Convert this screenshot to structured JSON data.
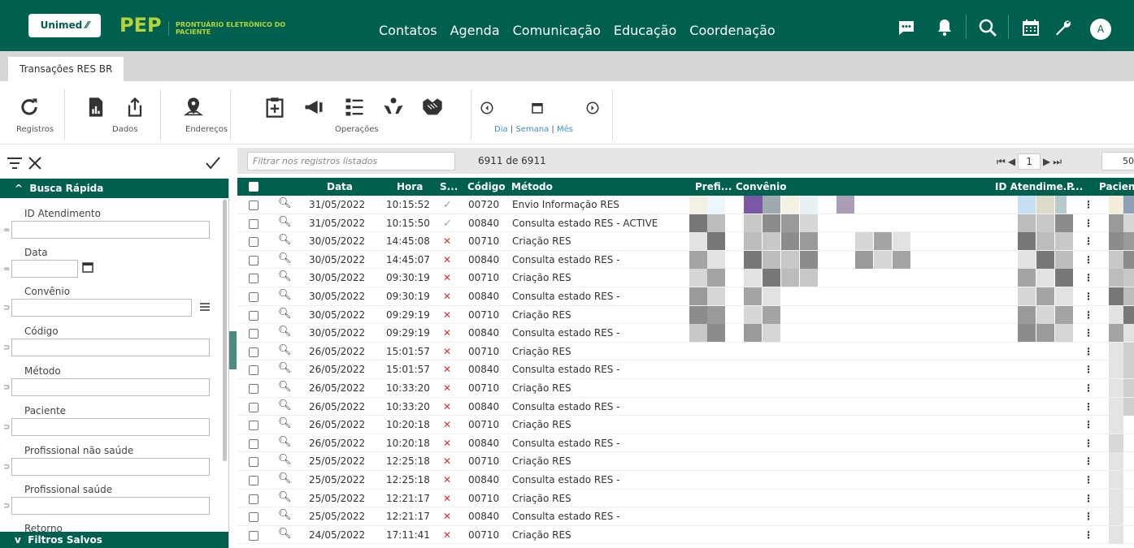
{
  "header": {
    "logo": "Unimed",
    "app_short": "PEP",
    "app_sub": "PRONTUÁRIO ELETRÔNICO DO PACIENTE",
    "nav": [
      "Contatos",
      "Agenda",
      "Comunicação",
      "Educação",
      "Coordenação"
    ],
    "avatar": "A"
  },
  "tab": {
    "label": "Transações RES BR"
  },
  "toolbar": {
    "registros": "Registros",
    "dados": "Dados",
    "enderecos": "Endereços",
    "operacoes": "Operações",
    "dia": "Dia",
    "semana": "Semana",
    "mes": "Mês"
  },
  "leftpanel": {
    "busca": "Busca Rápida",
    "filtros": "Filtros Salvos",
    "fields": [
      {
        "label": "ID Atendimento",
        "op": "="
      },
      {
        "label": "Data",
        "op": "="
      },
      {
        "label": "Convênio",
        "op": "⊃"
      },
      {
        "label": "Código",
        "op": "⊃"
      },
      {
        "label": "Método",
        "op": "⊃"
      },
      {
        "label": "Paciente",
        "op": "⊃"
      },
      {
        "label": "Profissional não saúde",
        "op": "⊃"
      },
      {
        "label": "Profissional saúde",
        "op": "⊃"
      },
      {
        "label": "Retorno",
        "op": ""
      }
    ]
  },
  "grid": {
    "filter_placeholder": "Filtrar nos registros listados",
    "count": "6911 de 6911",
    "page": "1",
    "per_page": "50",
    "columns": {
      "data": "Data",
      "hora": "Hora",
      "status": "S...",
      "codigo": "Código",
      "metodo": "Método",
      "prefixo": "Prefi...",
      "convenio": "Convênio",
      "id_atendimento": "ID Atendime...",
      "p": "P...",
      "paciente": "Pacient"
    },
    "rows": [
      {
        "data": "31/05/2022",
        "hora": "10:15:52",
        "ok": true,
        "codigo": "00720",
        "metodo": "Envio Informação RES"
      },
      {
        "data": "31/05/2022",
        "hora": "10:15:50",
        "ok": true,
        "codigo": "00840",
        "metodo": "Consulta estado RES - ACTIVE"
      },
      {
        "data": "30/05/2022",
        "hora": "14:45:08",
        "ok": false,
        "codigo": "00710",
        "metodo": "Criação RES"
      },
      {
        "data": "30/05/2022",
        "hora": "14:45:07",
        "ok": false,
        "codigo": "00840",
        "metodo": "Consulta estado RES -"
      },
      {
        "data": "30/05/2022",
        "hora": "09:30:19",
        "ok": false,
        "codigo": "00710",
        "metodo": "Criação RES"
      },
      {
        "data": "30/05/2022",
        "hora": "09:30:19",
        "ok": false,
        "codigo": "00840",
        "metodo": "Consulta estado RES -"
      },
      {
        "data": "30/05/2022",
        "hora": "09:29:19",
        "ok": false,
        "codigo": "00710",
        "metodo": "Criação RES"
      },
      {
        "data": "30/05/2022",
        "hora": "09:29:19",
        "ok": false,
        "codigo": "00840",
        "metodo": "Consulta estado RES -"
      },
      {
        "data": "26/05/2022",
        "hora": "15:01:57",
        "ok": false,
        "codigo": "00710",
        "metodo": "Criação RES"
      },
      {
        "data": "26/05/2022",
        "hora": "15:01:57",
        "ok": false,
        "codigo": "00840",
        "metodo": "Consulta estado RES -"
      },
      {
        "data": "26/05/2022",
        "hora": "10:33:20",
        "ok": false,
        "codigo": "00710",
        "metodo": "Criação RES"
      },
      {
        "data": "26/05/2022",
        "hora": "10:33:20",
        "ok": false,
        "codigo": "00840",
        "metodo": "Consulta estado RES -"
      },
      {
        "data": "26/05/2022",
        "hora": "10:20:18",
        "ok": false,
        "codigo": "00710",
        "metodo": "Criação RES"
      },
      {
        "data": "26/05/2022",
        "hora": "10:20:18",
        "ok": false,
        "codigo": "00840",
        "metodo": "Consulta estado RES -"
      },
      {
        "data": "25/05/2022",
        "hora": "12:25:18",
        "ok": false,
        "codigo": "00710",
        "metodo": "Criação RES"
      },
      {
        "data": "25/05/2022",
        "hora": "12:25:18",
        "ok": false,
        "codigo": "00840",
        "metodo": "Consulta estado RES -"
      },
      {
        "data": "25/05/2022",
        "hora": "12:21:17",
        "ok": false,
        "codigo": "00710",
        "metodo": "Criação RES"
      },
      {
        "data": "25/05/2022",
        "hora": "12:21:17",
        "ok": false,
        "codigo": "00840",
        "metodo": "Consulta estado RES -"
      },
      {
        "data": "24/05/2022",
        "hora": "17:11:41",
        "ok": false,
        "codigo": "00710",
        "metodo": "Criação RES"
      }
    ]
  },
  "icons": {
    "ok": "check-icon",
    "err": "x-icon"
  },
  "colors": {
    "brand": "#00604f",
    "accent": "#b6d43a",
    "error": "#e0302f",
    "link": "#3b8fd0"
  }
}
